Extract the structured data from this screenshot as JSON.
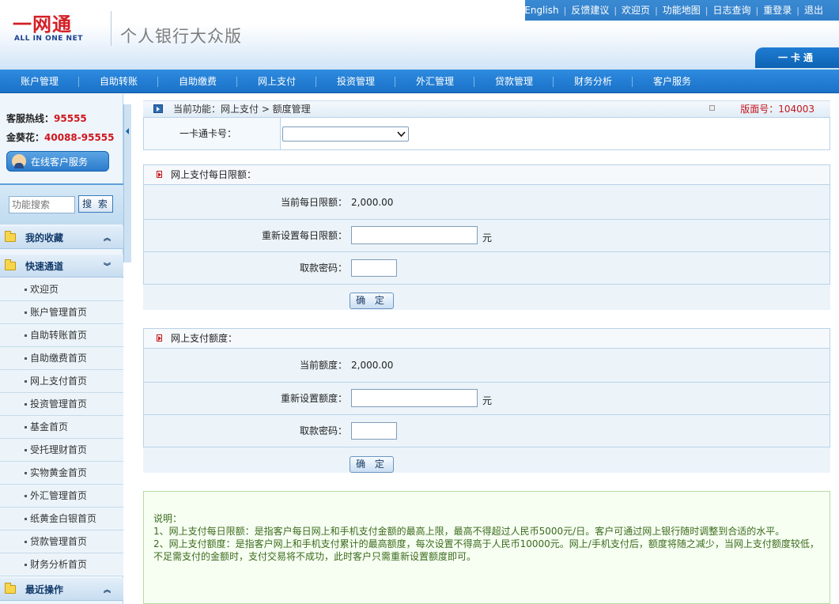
{
  "header": {
    "logo_main": "一网通",
    "logo_sub": "ALL IN ONE NET",
    "title": "个人银行大众版",
    "links": [
      "English",
      "反馈建议",
      "欢迎页",
      "功能地图",
      "日志查询",
      "重登录",
      "退出"
    ],
    "card_tab": "一卡通"
  },
  "nav": {
    "items": [
      "账户管理",
      "自助转账",
      "自助缴费",
      "网上支付",
      "投资管理",
      "外汇管理",
      "贷款管理",
      "财务分析",
      "客户服务"
    ]
  },
  "sidebar": {
    "hotline_label": "客服热线：",
    "hotline_number": "95555",
    "sunflower_label": "金葵花：",
    "sunflower_number": "40088-95555",
    "online_service": "在线客户服务",
    "search_placeholder": "功能搜索",
    "search_button": "搜 索",
    "favorites": "我的收藏",
    "quick_access": "快速通道",
    "items": [
      "欢迎页",
      "账户管理首页",
      "自助转账首页",
      "自助缴费首页",
      "网上支付首页",
      "投资管理首页",
      "基金首页",
      "受托理财首页",
      "实物黄金首页",
      "外汇管理首页",
      "纸黄金白银首页",
      "贷款管理首页",
      "财务分析首页"
    ],
    "recent": "最近操作"
  },
  "crumb": {
    "text": "当前功能：网上支付 > 额度管理",
    "version": "版面号：104003"
  },
  "card": {
    "label": "一卡通卡号：",
    "selected": ""
  },
  "daily": {
    "title": "网上支付每日限额：",
    "current_label": "当前每日限额：",
    "current_value": "2,000.00",
    "reset_label": "重新设置每日限额：",
    "unit": "元",
    "password_label": "取款密码：",
    "confirm": "确 定"
  },
  "quota": {
    "title": "网上支付额度：",
    "current_label": "当前额度：",
    "current_value": "2,000.00",
    "reset_label": "重新设置额度：",
    "unit": "元",
    "password_label": "取款密码：",
    "confirm": "确 定"
  },
  "notes": {
    "title": "说明：",
    "line1": "1、网上支付每日限额：是指客户每日网上和手机支付金额的最高上限，最高不得超过人民币5000元/日。客户可通过网上银行随时调整到合适的水平。",
    "line2": "2、网上支付额度：是指客户网上和手机支付累计的最高额度，每次设置不得高于人民币10000元。网上/手机支付后，额度将随之减少，当网上支付额度较低，不足需支付的金额时，支付交易将不成功，此时客户只需重新设置额度即可。"
  },
  "colors": {
    "brand_red": "#d51f26",
    "nav_blue": "#1a72c7",
    "notes_green": "#3c6a1c"
  }
}
